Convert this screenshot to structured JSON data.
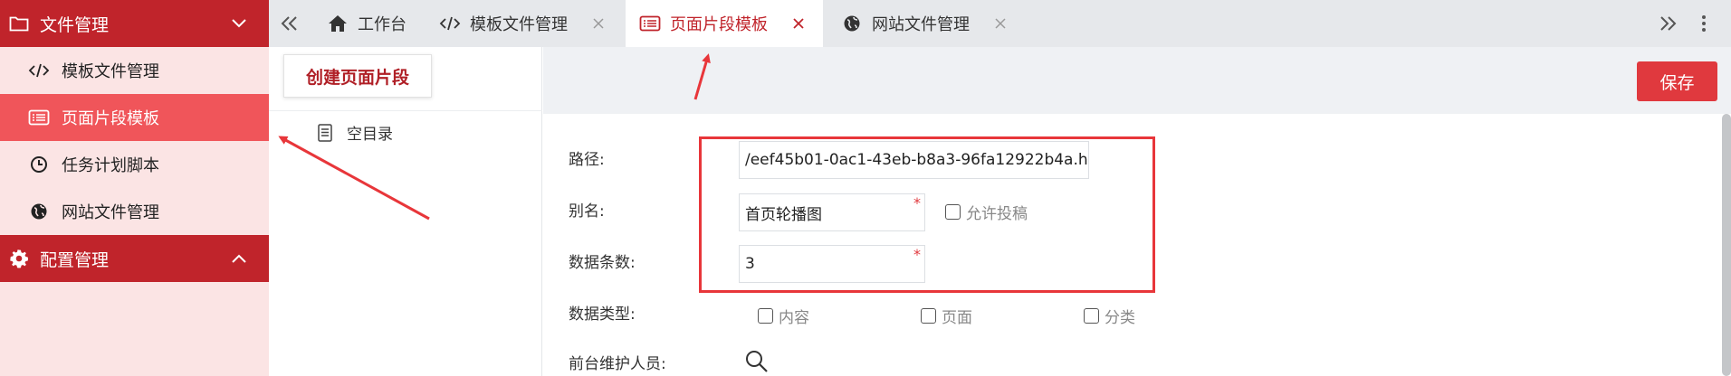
{
  "sidebar": {
    "group_file": {
      "label": "文件管理",
      "icon": "folder-icon",
      "chevron": "chevron-down-icon"
    },
    "items": [
      {
        "label": "模板文件管理",
        "icon": "code-icon",
        "active": false
      },
      {
        "label": "页面片段模板",
        "icon": "list-icon",
        "active": true
      },
      {
        "label": "任务计划脚本",
        "icon": "clock-icon",
        "active": false
      },
      {
        "label": "网站文件管理",
        "icon": "globe-icon",
        "active": false
      }
    ],
    "group_config": {
      "label": "配置管理",
      "icon": "gear-icon",
      "chevron": "chevron-up-icon"
    }
  },
  "tabs": [
    {
      "label": "工作台",
      "icon": "home-icon",
      "closable": false
    },
    {
      "label": "模板文件管理",
      "icon": "code-icon",
      "closable": true
    },
    {
      "label": "页面片段模板",
      "icon": "list-icon",
      "closable": true,
      "active": true
    },
    {
      "label": "网站文件管理",
      "icon": "globe-icon",
      "closable": true
    }
  ],
  "tree": {
    "create_button": "创建页面片段",
    "nodes": [
      {
        "label": "空目录",
        "icon": "document-icon"
      }
    ]
  },
  "toolbar": {
    "save_label": "保存"
  },
  "form": {
    "path": {
      "label": "路径:",
      "value": "/eef45b01-0ac1-43eb-b8a3-96fa12922b4a.h"
    },
    "alias": {
      "label": "别名:",
      "value": "首页轮播图",
      "required_mark": "*"
    },
    "allow_submit": {
      "label": "允许投稿",
      "checked": false
    },
    "data_count": {
      "label": "数据条数:",
      "value": "3",
      "required_mark": "*"
    },
    "data_type": {
      "label": "数据类型:",
      "options": [
        {
          "label": "内容",
          "checked": false
        },
        {
          "label": "页面",
          "checked": false
        },
        {
          "label": "分类",
          "checked": false
        }
      ]
    },
    "maintainers": {
      "label": "前台维护人员:",
      "icon": "search-icon"
    }
  },
  "colors": {
    "brand_red": "#c0242b",
    "active_item": "#f0555a",
    "sidebar_bg": "#fbe4e4",
    "annotation_red": "#e8363a"
  }
}
